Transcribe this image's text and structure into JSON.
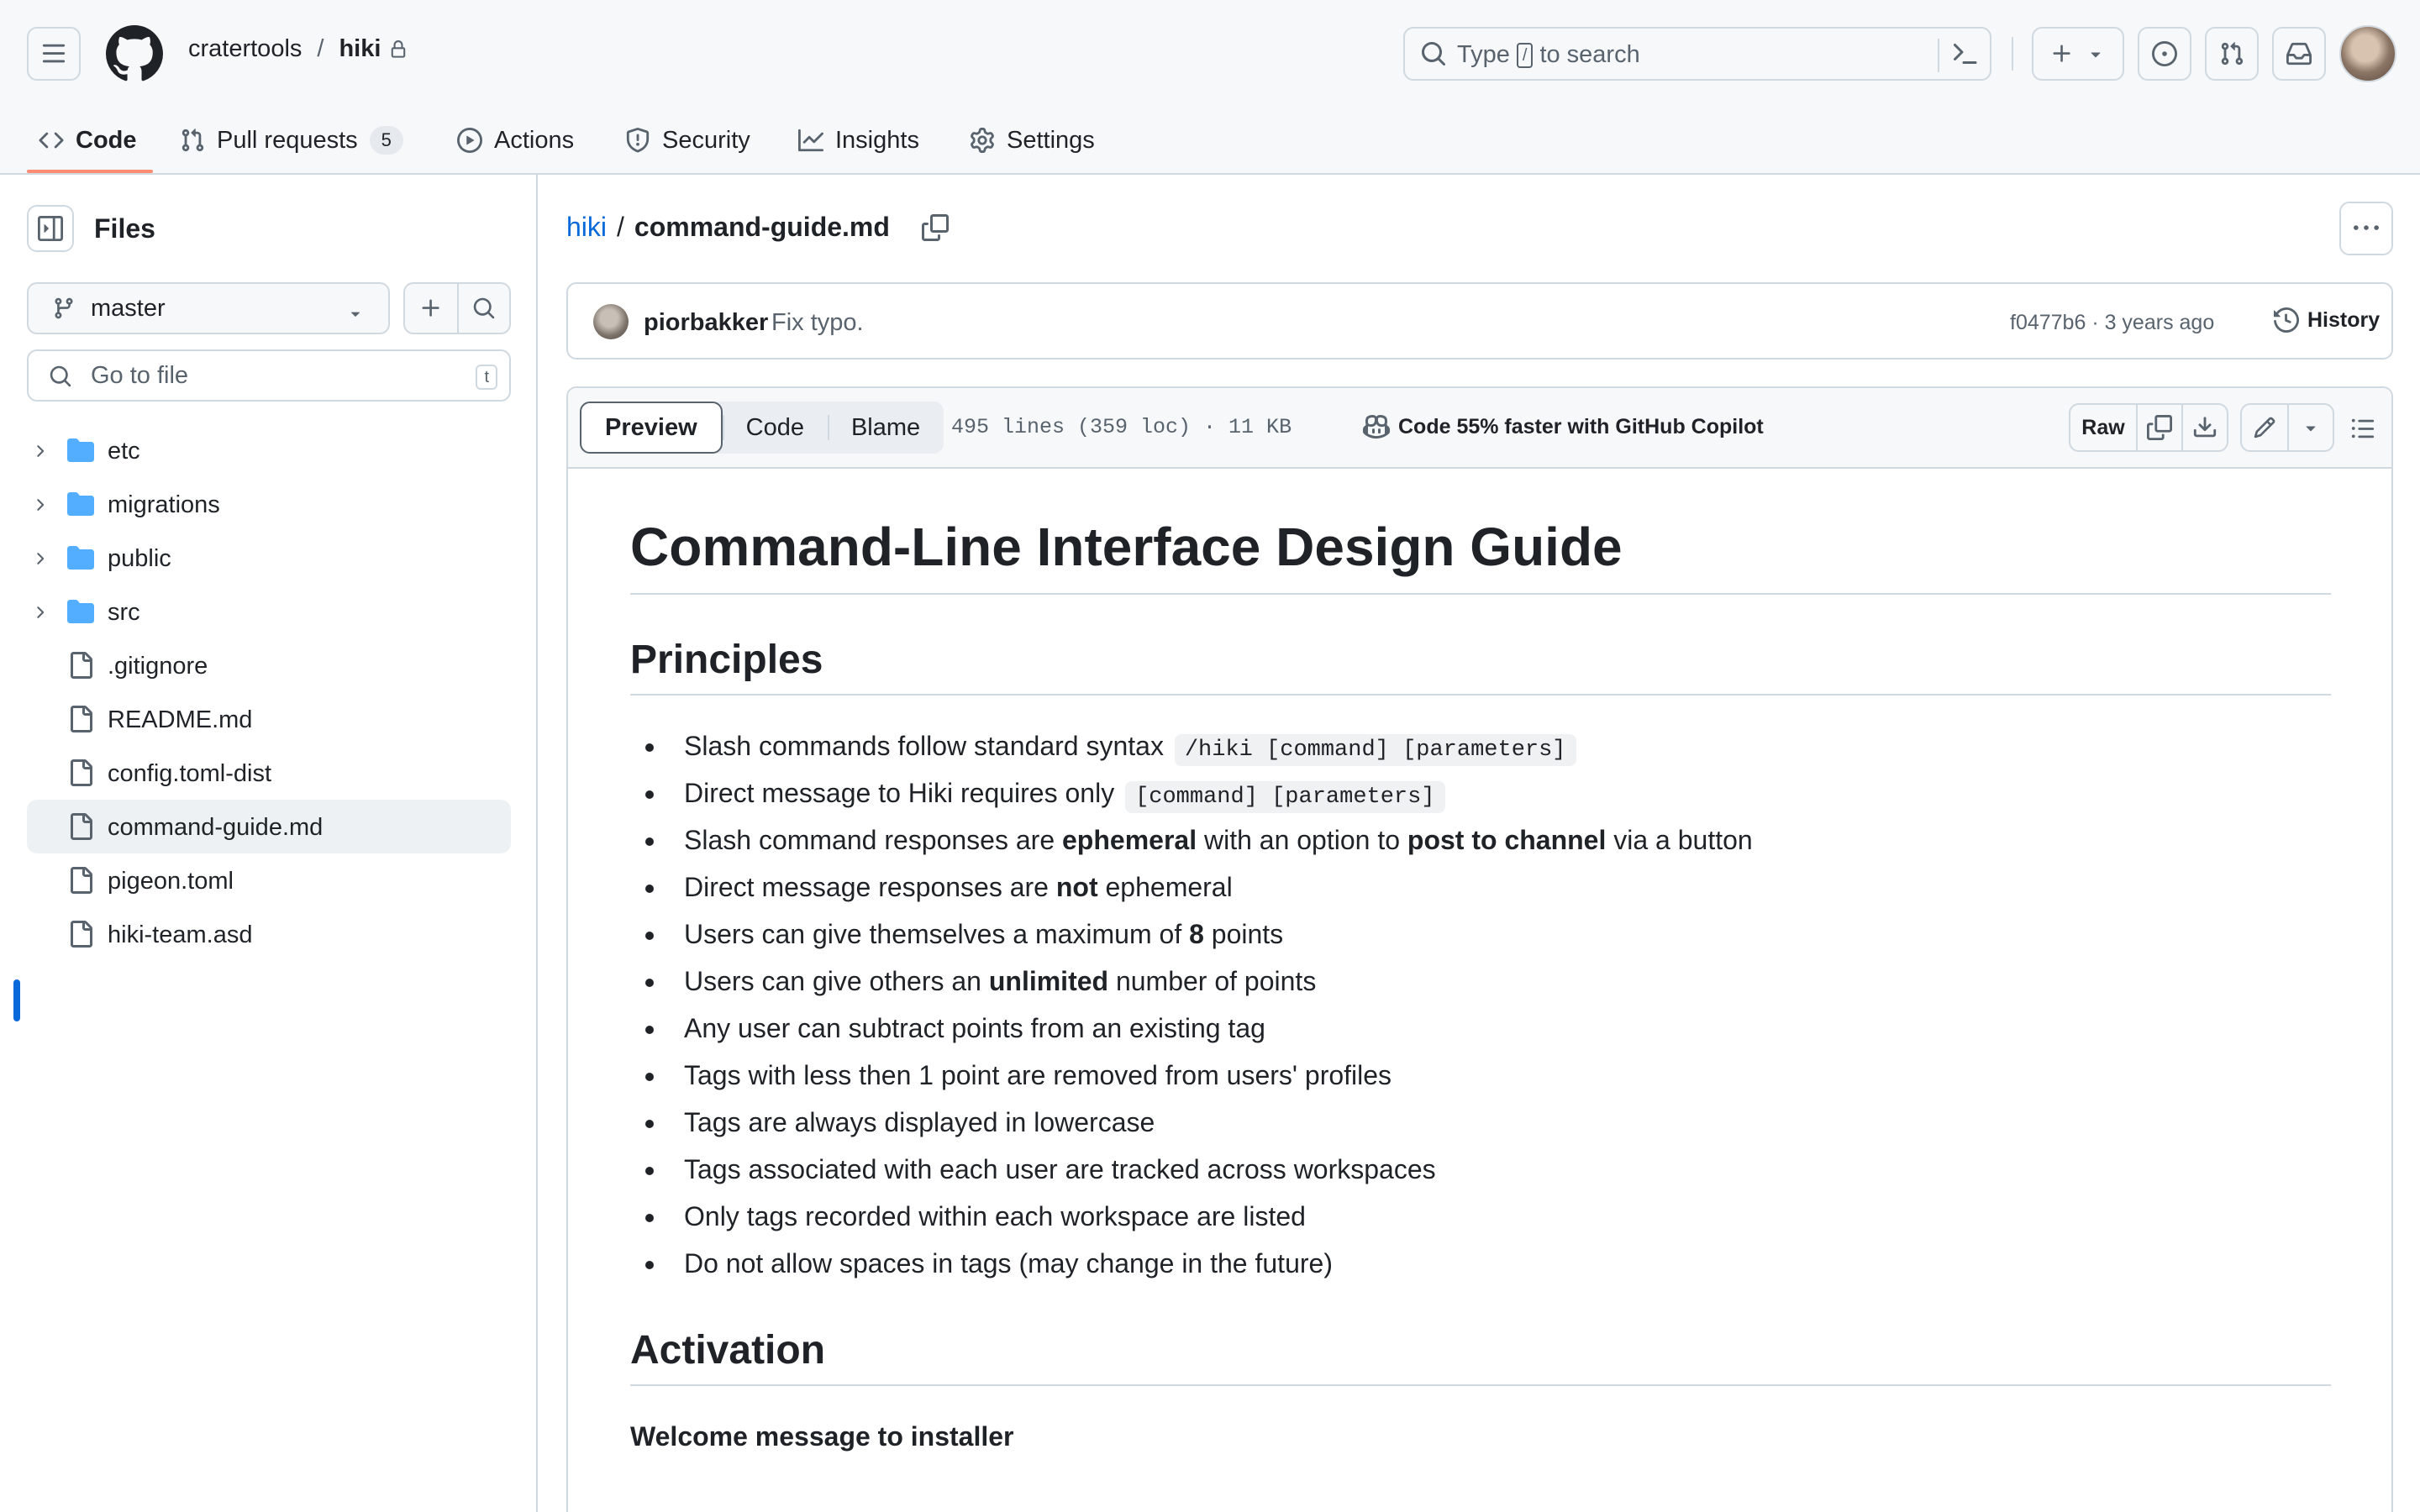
{
  "header": {
    "owner": "cratertools",
    "separator": "/",
    "repo": "hiki",
    "search": {
      "prefix": "Type",
      "key": "/",
      "suffix": "to search"
    }
  },
  "tabs": [
    {
      "label": "Code"
    },
    {
      "label": "Pull requests",
      "count": "5"
    },
    {
      "label": "Actions"
    },
    {
      "label": "Security"
    },
    {
      "label": "Insights"
    },
    {
      "label": "Settings"
    }
  ],
  "sidebar": {
    "title": "Files",
    "branch": "master",
    "goto_placeholder": "Go to file",
    "goto_key": "t",
    "items": [
      {
        "name": "etc",
        "type": "folder"
      },
      {
        "name": "migrations",
        "type": "folder"
      },
      {
        "name": "public",
        "type": "folder"
      },
      {
        "name": "src",
        "type": "folder"
      },
      {
        "name": ".gitignore",
        "type": "file"
      },
      {
        "name": "README.md",
        "type": "file"
      },
      {
        "name": "config.toml-dist",
        "type": "file"
      },
      {
        "name": "command-guide.md",
        "type": "file",
        "selected": true
      },
      {
        "name": "pigeon.toml",
        "type": "file"
      },
      {
        "name": "hiki-team.asd",
        "type": "file"
      }
    ]
  },
  "file": {
    "repo_link": "hiki",
    "separator": "/",
    "name": "command-guide.md"
  },
  "commit": {
    "author": "piorbakker",
    "message": "Fix typo.",
    "meta": "f0477b6 · 3 years ago",
    "history_label": "History"
  },
  "file_header": {
    "tabs": [
      "Preview",
      "Code",
      "Blame"
    ],
    "stats": "495 lines (359 loc) · 11 KB",
    "copilot": "Code 55% faster with GitHub Copilot",
    "raw_label": "Raw"
  },
  "markdown": {
    "h1": "Command-Line Interface Design Guide",
    "h2_principles": "Principles",
    "principles": {
      "p1_text": "Slash commands follow standard syntax",
      "p1_code": "/hiki [command] [parameters]",
      "p2_text": "Direct message to Hiki requires only",
      "p2_code": "[command] [parameters]",
      "p3_a": "Slash command responses are ",
      "p3_b": "ephemeral",
      "p3_c": " with an option to ",
      "p3_d": "post to channel",
      "p3_e": " via a button",
      "p4_a": "Direct message responses are ",
      "p4_b": "not",
      "p4_c": " ephemeral",
      "p5_a": "Users can give themselves a maximum of ",
      "p5_b": "8",
      "p5_c": " points",
      "p6_a": "Users can give others an ",
      "p6_b": "unlimited",
      "p6_c": " number of points",
      "p7": "Any user can subtract points from an existing tag",
      "p8": "Tags with less then 1 point are removed from users' profiles",
      "p9": "Tags are always displayed in lowercase",
      "p10": "Tags associated with each user are tracked across workspaces",
      "p11": "Only tags recorded within each workspace are listed",
      "p12": "Do not allow spaces in tags (may change in the future)"
    },
    "h2_activation": "Activation",
    "h4_welcome": "Welcome message to installer"
  },
  "colors": {
    "accent": "#0969da",
    "tab_underline": "#fd8c73",
    "border": "#d1d9e0",
    "muted": "#59636e"
  }
}
